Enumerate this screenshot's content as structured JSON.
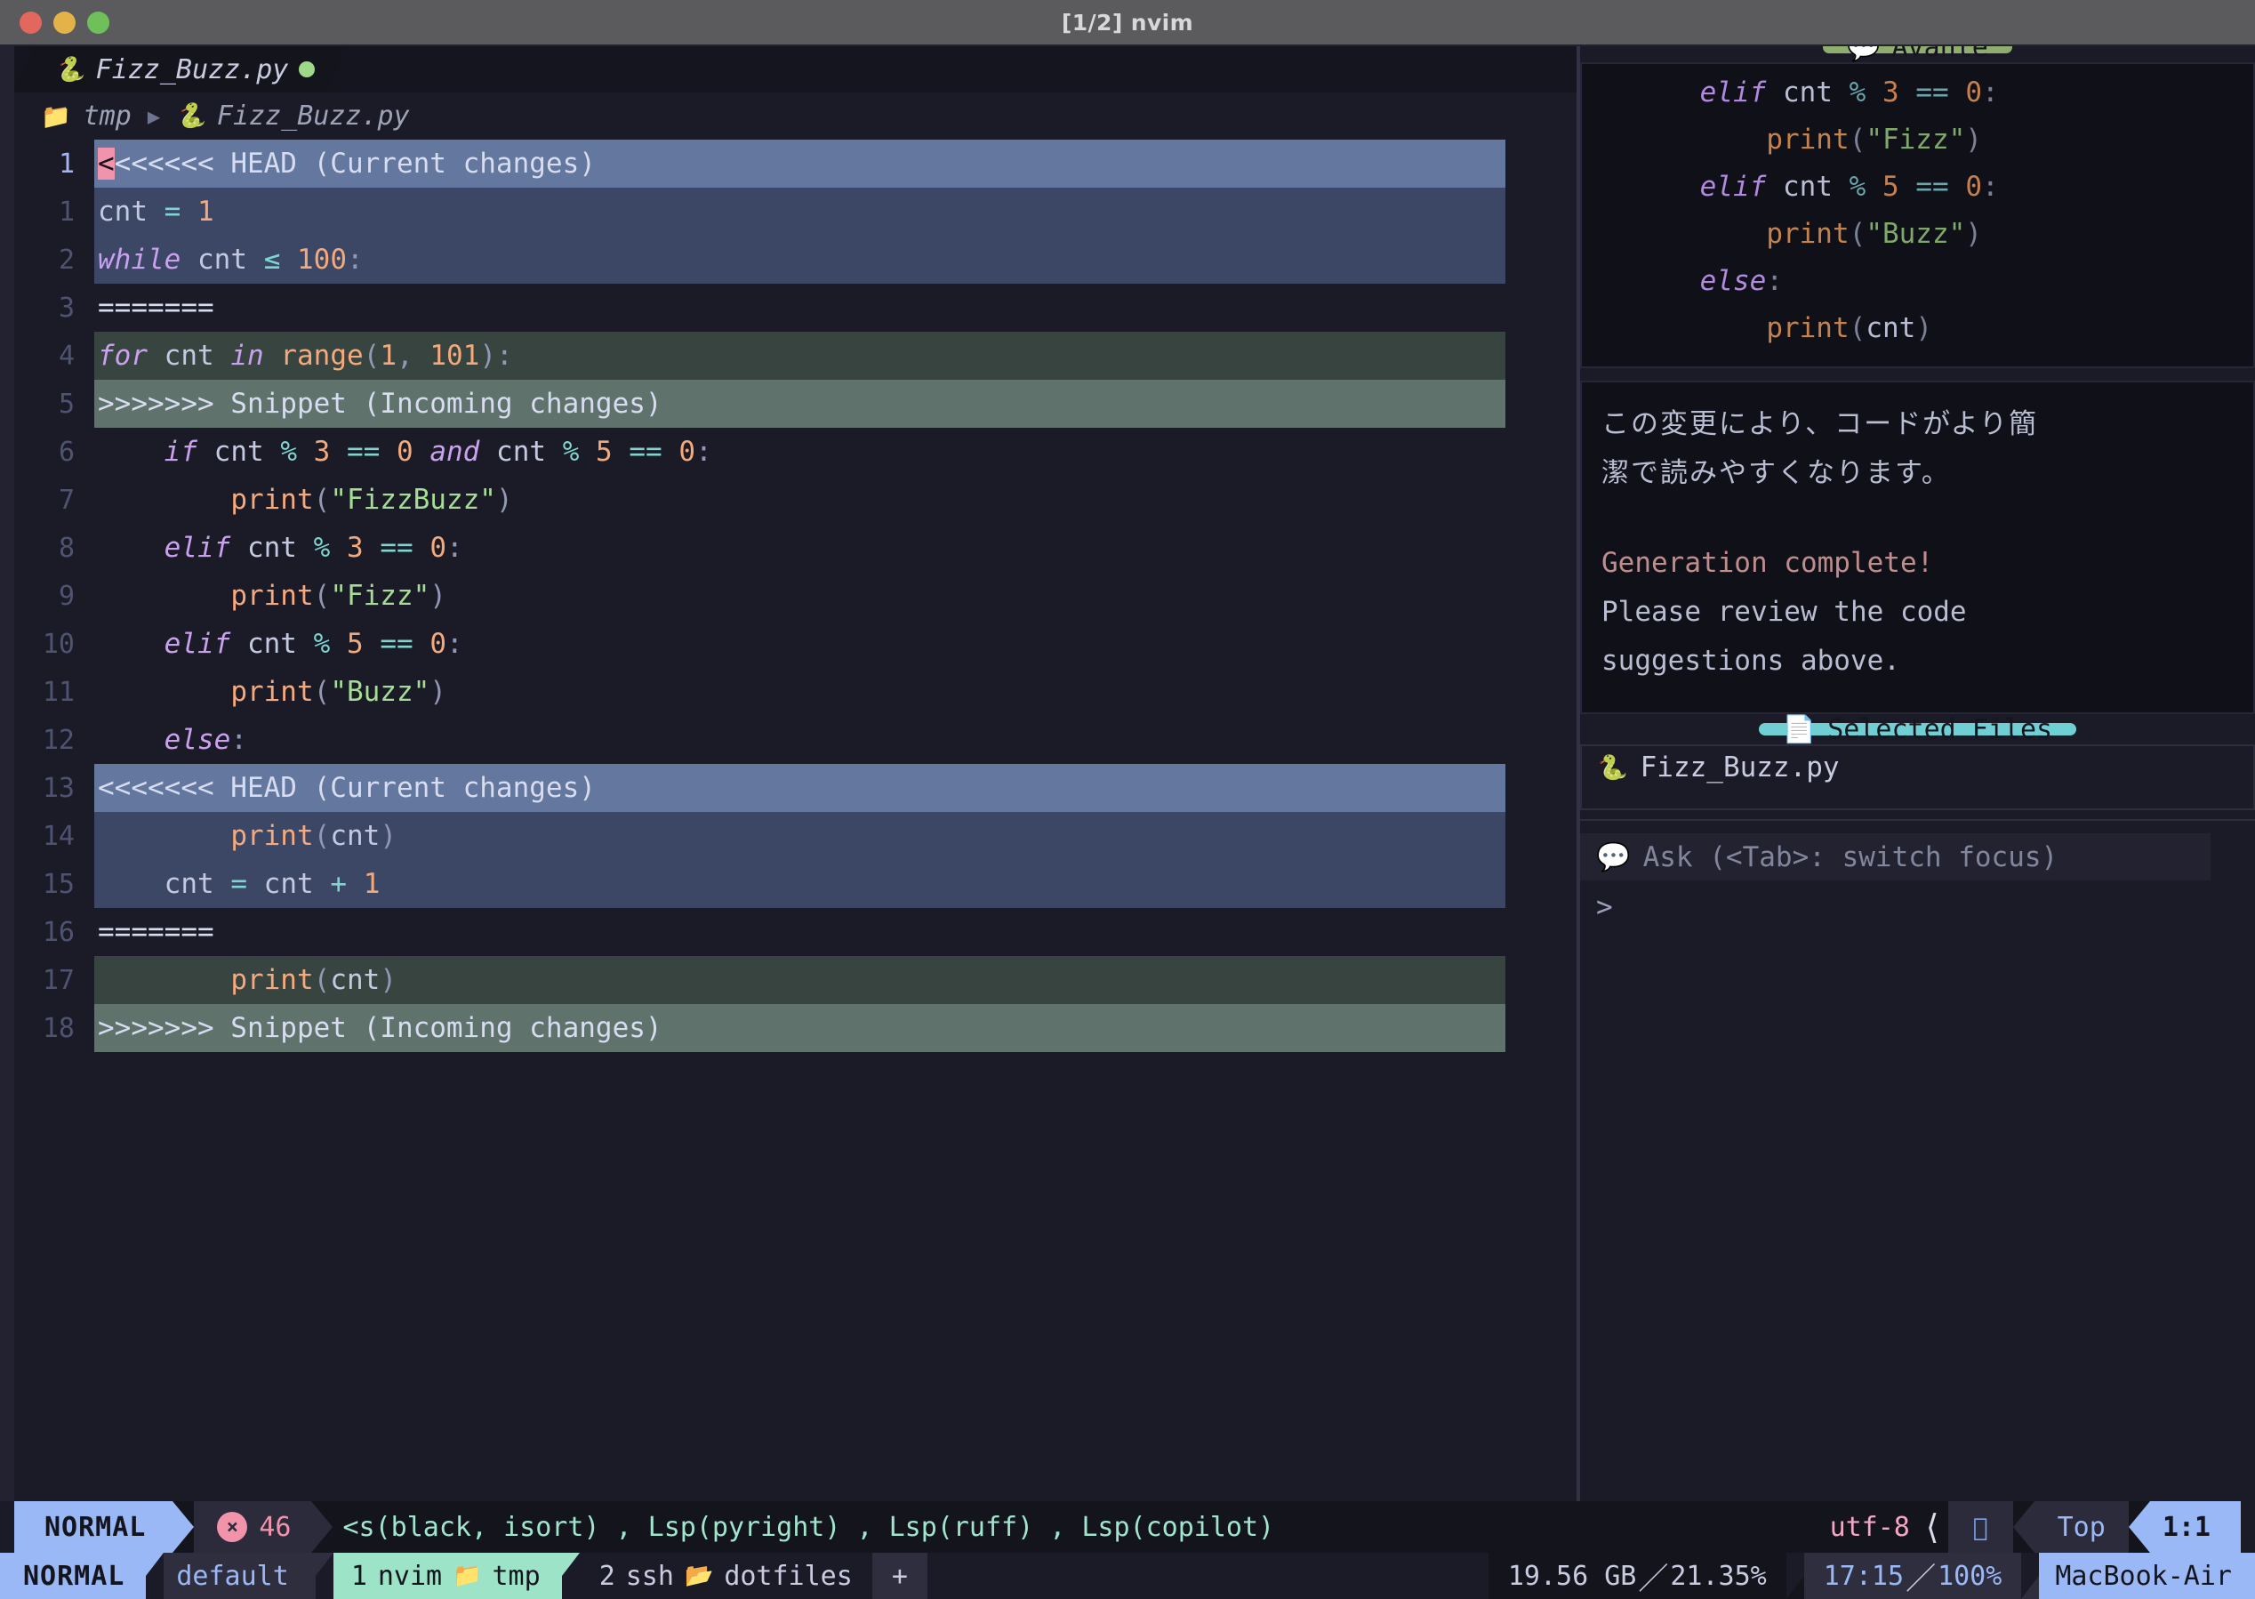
{
  "window": {
    "title": "[1/2] nvim",
    "traffic_lights": [
      "close",
      "minimize",
      "maximize"
    ]
  },
  "tabline": {
    "tabs": [
      {
        "icon": "python-icon",
        "label": "Fizz_Buzz.py",
        "modified": true
      }
    ]
  },
  "winbar": {
    "folder": "tmp",
    "separator": "▶",
    "file": "Fizz_Buzz.py"
  },
  "editor": {
    "cursor_line_number": "1",
    "lines": [
      {
        "n": "1",
        "kind": "conflict-head-label",
        "text": "<<<<<<< HEAD (Current changes)"
      },
      {
        "n": "1",
        "kind": "conflict-head-body",
        "text": "cnt = 1"
      },
      {
        "n": "2",
        "kind": "conflict-head-body",
        "text": "while cnt ≤ 100:"
      },
      {
        "n": "3",
        "kind": "plain",
        "text": "======="
      },
      {
        "n": "4",
        "kind": "conflict-inc-body",
        "text": "for cnt in range(1, 101):"
      },
      {
        "n": "5",
        "kind": "conflict-inc-label",
        "text": ">>>>>>> Snippet (Incoming changes)"
      },
      {
        "n": "6",
        "kind": "plain",
        "text": "    if cnt % 3 == 0 and cnt % 5 == 0:"
      },
      {
        "n": "7",
        "kind": "plain",
        "text": "        print(\"FizzBuzz\")"
      },
      {
        "n": "8",
        "kind": "plain",
        "text": "    elif cnt % 3 == 0:"
      },
      {
        "n": "9",
        "kind": "plain",
        "text": "        print(\"Fizz\")"
      },
      {
        "n": "10",
        "kind": "plain",
        "text": "    elif cnt % 5 == 0:"
      },
      {
        "n": "11",
        "kind": "plain",
        "text": "        print(\"Buzz\")"
      },
      {
        "n": "12",
        "kind": "plain",
        "text": "    else:"
      },
      {
        "n": "13",
        "kind": "conflict-head-label",
        "text": "<<<<<<< HEAD (Current changes)"
      },
      {
        "n": "14",
        "kind": "conflict-head-body",
        "text": "        print(cnt)"
      },
      {
        "n": "15",
        "kind": "conflict-head-body",
        "text": "    cnt = cnt + 1"
      },
      {
        "n": "16",
        "kind": "plain",
        "text": "======="
      },
      {
        "n": "17",
        "kind": "conflict-inc-body",
        "text": "        print(cnt)"
      },
      {
        "n": "18",
        "kind": "conflict-inc-label",
        "text": ">>>>>>> Snippet (Incoming changes)"
      }
    ]
  },
  "avante": {
    "header_badge": {
      "icon": "chat-bubble-icon",
      "label": "Avante"
    },
    "code_lines": [
      "    elif cnt % 3 == 0:",
      "        print(\"Fizz\")",
      "    elif cnt % 5 == 0:",
      "        print(\"Buzz\")",
      "    else:",
      "        print(cnt)"
    ],
    "japanese_text": "この変更により、コードがより簡\n潔で読みやすくなります。",
    "generation_status": "Generation complete!",
    "review_note": "Please review the code\nsuggestions above.",
    "files_badge": {
      "icon": "file-icon",
      "label": "Selected Files"
    },
    "selected_files": [
      {
        "icon": "python-icon",
        "name": "Fizz_Buzz.py"
      }
    ],
    "input_placeholder": "Ask (<Tab>: switch focus)",
    "input_prompt": ">",
    "input_value": ""
  },
  "statusline": {
    "mode": "NORMAL",
    "diagnostics": {
      "icon": "error-icon",
      "glyph": "×",
      "count": "46"
    },
    "lsp": "<s(black, isort) , Lsp(pyright) , Lsp(ruff) , Lsp(copilot)",
    "encoding": "utf-8",
    "os_icon": "apple-icon",
    "os_glyph": "",
    "scroll": "Top",
    "position": "1:1"
  },
  "tmux": {
    "mode": "NORMAL",
    "session": "default",
    "windows": [
      {
        "index": "1",
        "name": "nvim",
        "icon": "folder-open-icon",
        "path": "tmp",
        "active": true
      },
      {
        "index": "2",
        "name": "ssh",
        "icon": "folder-icon",
        "path": "dotfiles",
        "active": false
      }
    ],
    "plus": "+",
    "memory": "19.56 GB",
    "cpu": "21.35%",
    "clock": "17:15",
    "battery": "100%",
    "host": "MacBook-Air",
    "divider": "／"
  },
  "colors": {
    "accent_blue": "#9ab8f5",
    "accent_mint": "#9ce3c8",
    "accent_teal": "#6fcfd2",
    "accent_green": "#8fad6d",
    "accent_pink": "#f093ab",
    "conflict_head": "#64779e",
    "conflict_incoming": "#5f726c",
    "background": "#1b1b27"
  }
}
